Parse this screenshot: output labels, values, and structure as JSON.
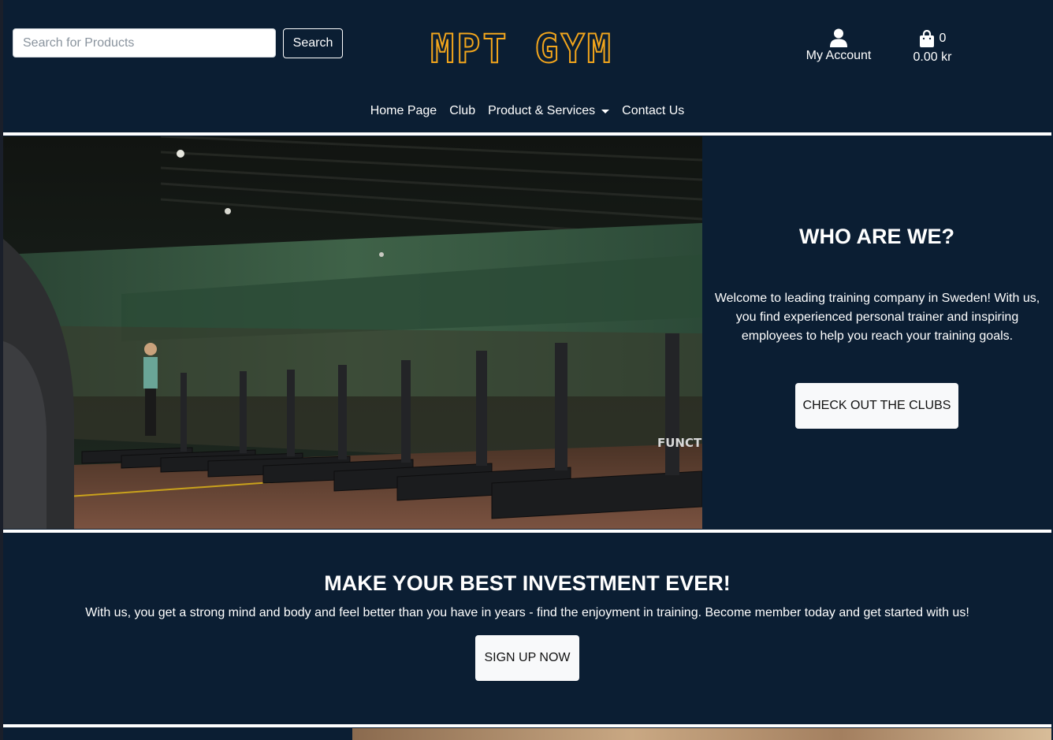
{
  "header": {
    "search": {
      "placeholder": "Search for Products",
      "value": ""
    },
    "search_button_label": "Search",
    "logo_text": "MPT GYM",
    "account_label": "My Account",
    "cart_count": "0",
    "cart_total": "0.00 kr"
  },
  "nav": {
    "items": [
      {
        "label": "Home Page"
      },
      {
        "label": "Club"
      },
      {
        "label": "Product & Services"
      },
      {
        "label": "Contact Us"
      }
    ]
  },
  "hero": {
    "title": "WHO ARE WE?",
    "text": "Welcome to leading training company in Sweden! With us, you find experienced personal trainer and inspiring employees to help you reach your training goals.",
    "button_label": "CHECK OUT THE CLUBS",
    "image_sign": "FUNCTI"
  },
  "invest": {
    "title": "MAKE YOUR BEST INVESTMENT EVER!",
    "text": "With us, you get a strong mind and body and feel better than you have in years - find the enjoyment in training. Become member today and get started with us!",
    "button_label": "SIGN UP NOW"
  },
  "colors": {
    "background": "#0b1e33",
    "logo_accent": "#f2a51c",
    "button_light": "#f8f9fa"
  }
}
